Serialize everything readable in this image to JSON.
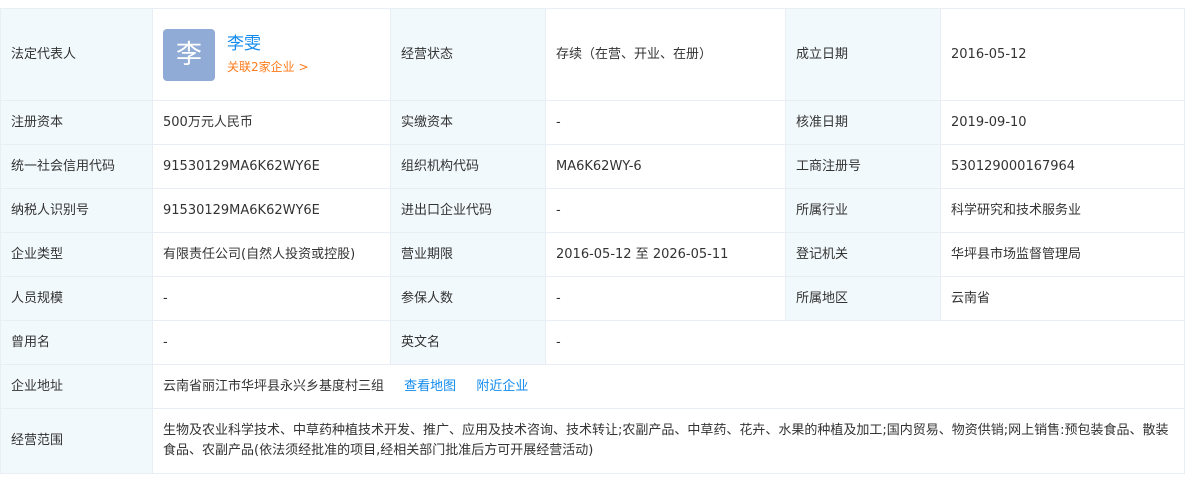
{
  "rows": {
    "legal_rep": {
      "label": "法定代表人",
      "avatar_char": "李",
      "name": "李雯",
      "linked": "关联2家企业 >",
      "status_label": "经营状态",
      "status_value": "存续（在营、开业、在册）",
      "found_label": "成立日期",
      "found_value": "2016-05-12"
    },
    "r1": {
      "l1": "注册资本",
      "v1": "500万元人民币",
      "l2": "实缴资本",
      "v2": "-",
      "l3": "核准日期",
      "v3": "2019-09-10"
    },
    "r2": {
      "l1": "统一社会信用代码",
      "v1": "91530129MA6K62WY6E",
      "l2": "组织机构代码",
      "v2": "MA6K62WY-6",
      "l3": "工商注册号",
      "v3": "530129000167964"
    },
    "r3": {
      "l1": "纳税人识别号",
      "v1": "91530129MA6K62WY6E",
      "l2": "进出口企业代码",
      "v2": "-",
      "l3": "所属行业",
      "v3": "科学研究和技术服务业"
    },
    "r4": {
      "l1": "企业类型",
      "v1": "有限责任公司(自然人投资或控股)",
      "l2": "营业期限",
      "v2": "2016-05-12 至 2026-05-11",
      "l3": "登记机关",
      "v3": "华坪县市场监督管理局"
    },
    "r5": {
      "l1": "人员规模",
      "v1": "-",
      "l2": "参保人数",
      "v2": "-",
      "l3": "所属地区",
      "v3": "云南省"
    },
    "r6": {
      "l1": "曾用名",
      "v1": "-",
      "l2": "英文名",
      "v2": "-"
    },
    "address": {
      "label": "企业地址",
      "value": "云南省丽江市华坪县永兴乡基度村三组",
      "map_link": "查看地图",
      "nearby_link": "附近企业"
    },
    "scope": {
      "label": "经营范围",
      "value": "生物及农业科学技术、中草药种植技术开发、推广、应用及技术咨询、技术转让;农副产品、中草药、花卉、水果的种植及加工;国内贸易、物资供销;网上销售:预包装食品、散装食品、农副产品(依法须经批准的项目,经相关部门批准后方可开展经营活动)"
    }
  },
  "colors": {
    "label_bg": "#f2f9fc",
    "border": "#e8eef4",
    "link": "#128bed",
    "accent": "#ff7a1a",
    "avatar_bg": "#90abd6"
  }
}
